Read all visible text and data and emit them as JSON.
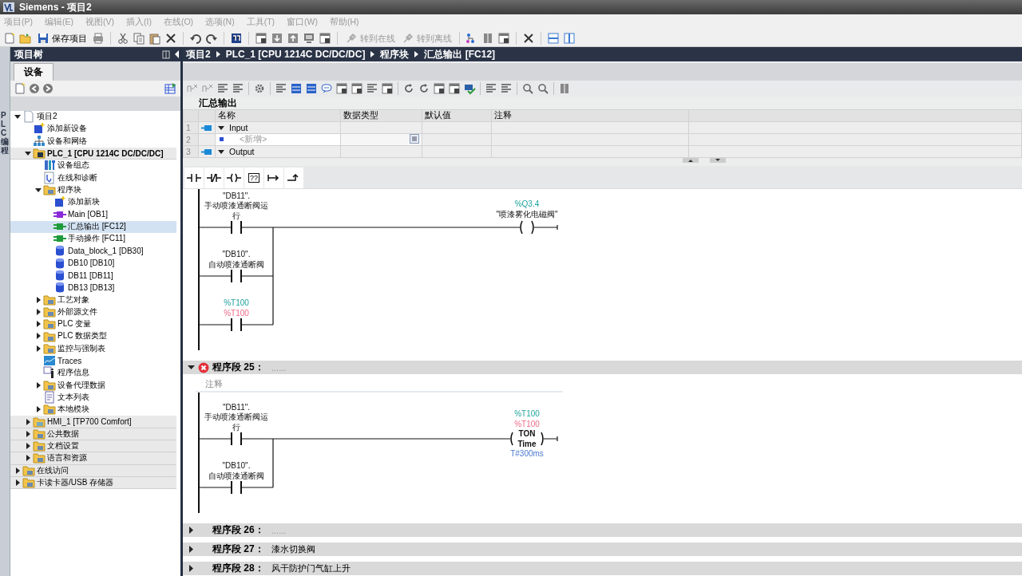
{
  "window": {
    "title": "Siemens  -  项目2"
  },
  "menu": [
    "项目(P)",
    "编辑(E)",
    "视图(V)",
    "插入(I)",
    "在线(O)",
    "选项(N)",
    "工具(T)",
    "窗口(W)",
    "帮助(H)"
  ],
  "toolbar": [
    {
      "label": "保存项目",
      "disabled": false
    },
    {
      "label": "转到在线",
      "disabled": true
    },
    {
      "label": "转到离线",
      "disabled": true
    }
  ],
  "side_strip": {
    "label": "PLC 编程"
  },
  "project_tree": {
    "title": "项目树",
    "tab": "设备",
    "items": [
      {
        "label": "项目2",
        "kind": "project",
        "expanded": true,
        "children": [
          {
            "label": "添加新设备",
            "kind": "add"
          },
          {
            "label": "设备和网络",
            "kind": "network"
          },
          {
            "label": "PLC_1 [CPU 1214C DC/DC/DC]",
            "kind": "plc",
            "expanded": true,
            "children": [
              {
                "label": "设备组态",
                "kind": "config"
              },
              {
                "label": "在线和诊断",
                "kind": "diagnostics"
              },
              {
                "label": "程序块",
                "kind": "folder",
                "expanded": true,
                "children": [
                  {
                    "label": "添加新块",
                    "kind": "add",
                    "selected": false
                  },
                  {
                    "label": "Main [OB1]",
                    "kind": "ob",
                    "selected": false
                  },
                  {
                    "label": "汇总输出 [FC12]",
                    "kind": "fc",
                    "selected": true
                  },
                  {
                    "label": "手动操作 [FC11]",
                    "kind": "fc",
                    "selected": false
                  },
                  {
                    "label": "Data_block_1 [DB30]",
                    "kind": "db",
                    "selected": false
                  },
                  {
                    "label": "DB10 [DB10]",
                    "kind": "db",
                    "selected": false
                  },
                  {
                    "label": "DB11 [DB11]",
                    "kind": "db",
                    "selected": false
                  },
                  {
                    "label": "DB13 [DB13]",
                    "kind": "db",
                    "selected": false
                  }
                ]
              },
              {
                "label": "工艺对象",
                "kind": "folder",
                "expanded": false
              },
              {
                "label": "外部源文件",
                "kind": "folder",
                "expanded": false
              },
              {
                "label": "PLC 变量",
                "kind": "folder",
                "expanded": false
              },
              {
                "label": "PLC 数据类型",
                "kind": "folder",
                "expanded": false
              },
              {
                "label": "监控与强制表",
                "kind": "folder",
                "expanded": false
              },
              {
                "label": "Traces",
                "kind": "trace"
              },
              {
                "label": "程序信息",
                "kind": "info"
              },
              {
                "label": "设备代理数据",
                "kind": "folder",
                "expanded": false
              },
              {
                "label": "文本列表",
                "kind": "textlist"
              },
              {
                "label": "本地模块",
                "kind": "folder",
                "expanded": false
              }
            ]
          },
          {
            "label": "HMI_1 [TP700 Comfort]",
            "kind": "device",
            "expanded": false
          },
          {
            "label": "公共数据",
            "kind": "folder",
            "expanded": false
          },
          {
            "label": "文档设置",
            "kind": "folder",
            "expanded": false
          },
          {
            "label": "语言和资源",
            "kind": "folder",
            "expanded": false
          }
        ]
      },
      {
        "label": "在线访问",
        "kind": "folder",
        "expanded": false
      },
      {
        "label": "卡读卡器/USB 存储器",
        "kind": "folder",
        "expanded": false
      }
    ]
  },
  "breadcrumb": [
    "项目2",
    "PLC_1 [CPU 1214C DC/DC/DC]",
    "程序块",
    "汇总输出 [FC12]"
  ],
  "block_title": "汇总输出",
  "interface": {
    "columns": [
      "名称",
      "数据类型",
      "默认值",
      "注释"
    ],
    "rows": [
      {
        "number": "1",
        "name": "Input",
        "kind": "section",
        "expanded": true
      },
      {
        "number": "2",
        "name": "<新增>",
        "kind": "add"
      },
      {
        "number": "3",
        "name": "Output",
        "kind": "section",
        "expanded": true
      }
    ]
  },
  "instruction_bar": [
    {
      "kind": "contact"
    },
    {
      "kind": "negated_contact"
    },
    {
      "kind": "coil"
    },
    {
      "kind": "box",
      "label": "??"
    },
    {
      "kind": "open_branch"
    },
    {
      "kind": "close_branch"
    }
  ],
  "networks": [
    {
      "contacts": [
        {
          "lines": [
            {
              "text": "\"DB11\".",
              "kind": "symbol"
            },
            {
              "text": "手动喷漆通断阀运",
              "kind": "symbol"
            },
            {
              "text": "行",
              "kind": "symbol"
            }
          ]
        },
        {
          "lines": [
            {
              "text": "\"DB10\".",
              "kind": "symbol"
            },
            {
              "text": "自动喷漆通断阀",
              "kind": "symbol"
            }
          ]
        },
        {
          "lines": [
            {
              "text": "%T100",
              "kind": "address"
            },
            {
              "text": "%T100",
              "kind": "error"
            }
          ]
        }
      ],
      "coil": {
        "kind": "coil",
        "lines": [
          {
            "text": "%Q3.4",
            "kind": "address"
          },
          {
            "text": "\"喷漆雾化电磁阀\"",
            "kind": "symbol"
          }
        ]
      }
    },
    {
      "header": {
        "title": "程序段 25：",
        "comment": "......",
        "expanded": true,
        "error": true
      },
      "comment_field": {
        "placeholder": "注释"
      },
      "contacts": [
        {
          "lines": [
            {
              "text": "\"DB11\".",
              "kind": "symbol"
            },
            {
              "text": "手动喷漆通断阀运",
              "kind": "symbol"
            },
            {
              "text": "行",
              "kind": "symbol"
            }
          ]
        },
        {
          "lines": [
            {
              "text": "\"DB10\".",
              "kind": "symbol"
            },
            {
              "text": "自动喷漆通断阀",
              "kind": "symbol"
            }
          ]
        }
      ],
      "coil": {
        "kind": "ton",
        "lines": [
          {
            "text": "%T100",
            "kind": "address"
          },
          {
            "text": "%T100",
            "kind": "error"
          },
          {
            "text": "TON",
            "kind": "type"
          },
          {
            "text": "Time",
            "kind": "type"
          },
          {
            "text": "T#300ms",
            "kind": "param"
          }
        ]
      }
    },
    {
      "header": {
        "title": "程序段 26：",
        "comment": "......",
        "expanded": false,
        "error": false
      }
    },
    {
      "header": {
        "title": "程序段 27：",
        "comment": "漆水切换阀",
        "expanded": false,
        "error": false
      }
    },
    {
      "header": {
        "title": "程序段 28：",
        "comment": "风干防护门气缸上升",
        "expanded": false,
        "error": false
      }
    }
  ]
}
